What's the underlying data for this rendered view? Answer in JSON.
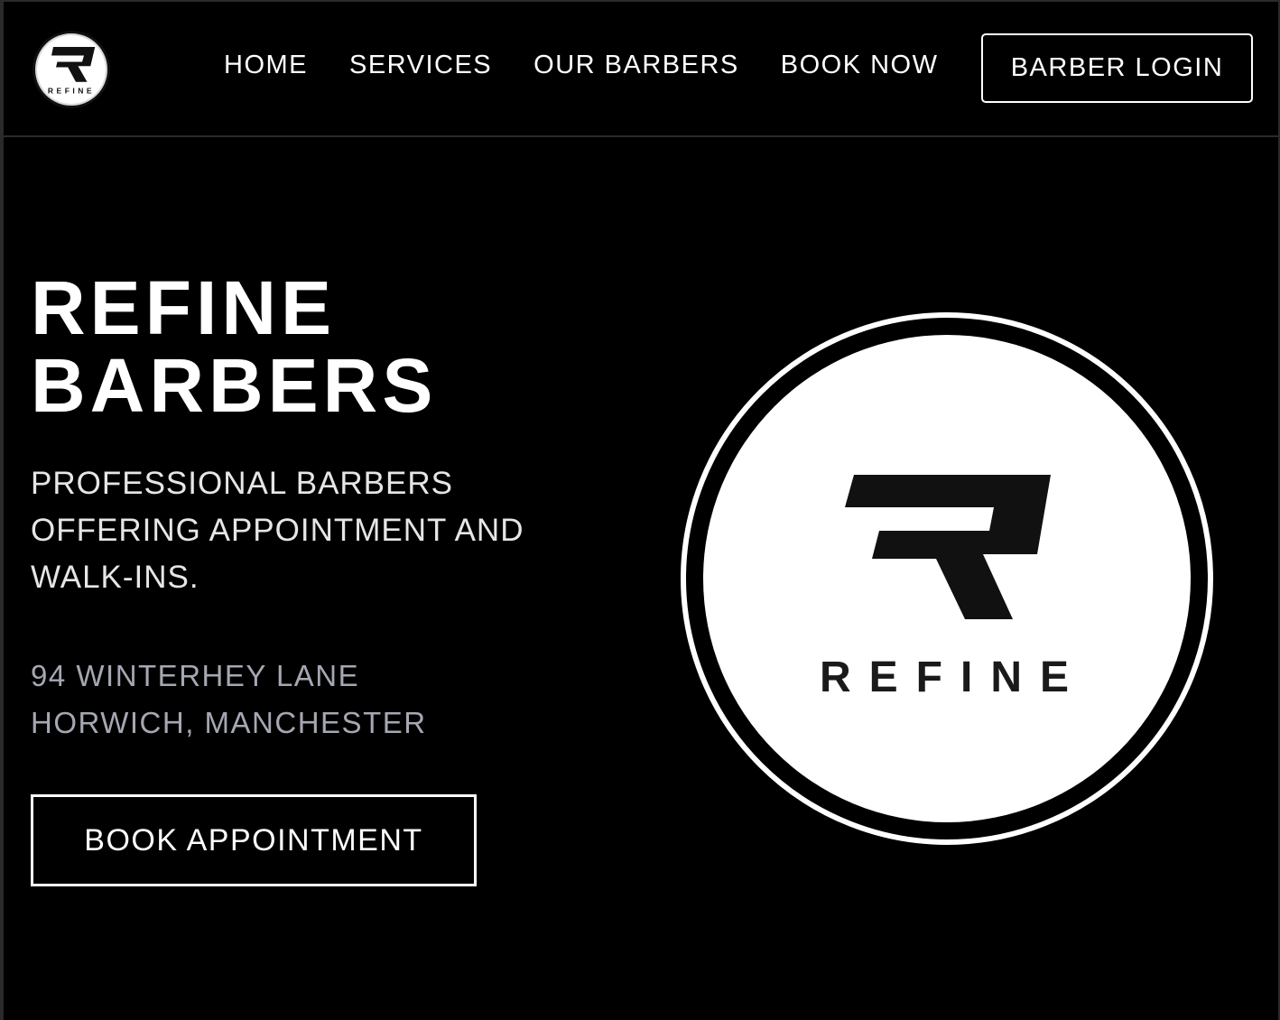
{
  "header": {
    "logo_text": "REFINE",
    "nav": [
      {
        "label": "HOME"
      },
      {
        "label": "SERVICES"
      },
      {
        "label": "OUR BARBERS"
      },
      {
        "label": "BOOK NOW"
      }
    ],
    "login_label": "BARBER LOGIN"
  },
  "hero": {
    "title_line1": "REFINE",
    "title_line2": "BARBERS",
    "subtitle_line1": "PROFESSIONAL BARBERS",
    "subtitle_line2": "OFFERING APPOINTMENT AND",
    "subtitle_line3": "WALK-INS.",
    "address_line1": "94 WINTERHEY LANE",
    "address_line2": "HORWICH, MANCHESTER",
    "cta_label": "BOOK APPOINTMENT",
    "logo_text": "REFINE"
  },
  "colors": {
    "background": "#000000",
    "text": "#ffffff",
    "subtitle": "#e6e6e6",
    "address": "#a5a7b2"
  },
  "icons": {
    "logo_mark": "refine-r-logo-icon"
  }
}
